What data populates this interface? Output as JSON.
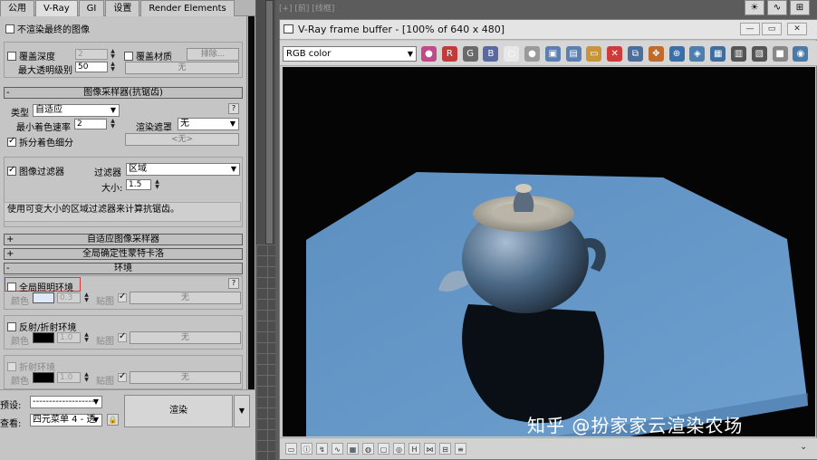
{
  "tabs": [
    "公用",
    "V-Ray",
    "GI",
    "设置",
    "Render Elements"
  ],
  "active_tab": "V-Ray",
  "settings": {
    "dont_render_final": "不渲染最终的图像",
    "override_depth": "覆盖深度",
    "override_depth_value": "2",
    "override_material": "覆盖材质",
    "exclude_btn": "排除...",
    "max_transp": "最大透明级别",
    "max_transp_value": "50",
    "none_btn": "无"
  },
  "sampler": {
    "title": "图像采样器(抗锯齿)",
    "type_label": "类型",
    "type_value": "自适应",
    "min_shading_label": "最小着色速率",
    "min_shading_value": "2",
    "render_mask_label": "渲染遮罩",
    "render_mask_value": "无",
    "divide_shading": "拆分着色细分",
    "none_disabled": "<无>",
    "filter_label": "图像过滤器",
    "filter_type_label": "过滤器",
    "filter_value": "区域",
    "size_label": "大小:",
    "size_value": "1.5",
    "note": "使用可变大小的区域过滤器来计算抗锯齿。",
    "help": "?"
  },
  "rollouts": {
    "adaptive": "自适应图像采样器",
    "global_dmc": "全局确定性蒙特卡洛",
    "environment": "环境"
  },
  "environment": {
    "gi_env": "全局照明环境",
    "color_label": "颜色",
    "gi_mult": "0.3",
    "map_label": "贴图",
    "none": "无",
    "refl_refr": "反射/折射环境",
    "refl_mult": "1.0",
    "refr_env": "折射环境",
    "refr_mult": "1.0",
    "help": "?",
    "colors": {
      "gi": "#dfe8f8",
      "refl": "#000000",
      "refr": "#000000"
    }
  },
  "bottom": {
    "preset_label": "预设:",
    "preset_value": "--------------------",
    "view_label": "查看:",
    "view_value": "四元菜单 4 - 透",
    "render_btn": "渲染"
  },
  "viewport": {
    "label": "[+] [前] [线框]"
  },
  "vfb": {
    "title": "V-Ray frame buffer - [100% of 640 x 480]",
    "channel": "RGB color",
    "toolbar_icons": [
      "color-wheel-icon",
      "r-channel-icon",
      "g-channel-icon",
      "b-channel-icon",
      "white-circle-icon",
      "gray-circle-icon",
      "save-icon",
      "save-all-icon",
      "open-icon",
      "clear-icon",
      "duplicate-icon",
      "region-icon",
      "track-mouse-icon",
      "lens-effects-icon",
      "display-correction-icon",
      "history-icon",
      "compare-icon",
      "stop-icon",
      "render-icon"
    ],
    "status_icons": [
      "frame-icon",
      "info-icon",
      "level-icon",
      "curve-icon",
      "exposure-icon",
      "lut-icon",
      "icc-icon",
      "ocio-icon",
      "h-icon",
      "v-icon",
      "split-icon",
      "scroll-icon"
    ]
  },
  "watermark": "知乎 @扮家家云渲染农场"
}
